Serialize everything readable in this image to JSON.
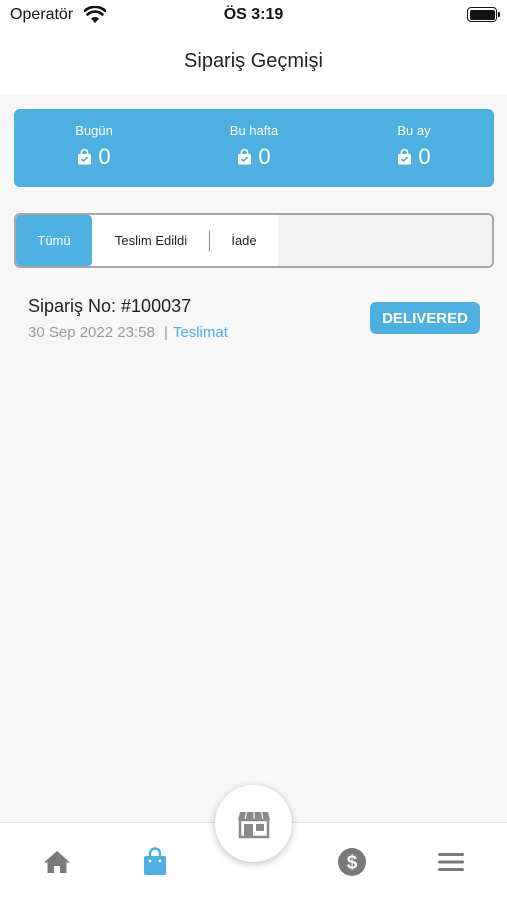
{
  "status_bar": {
    "carrier": "Operatör",
    "time": "ÖS 3:19"
  },
  "header": {
    "title": "Sipariş Geçmişi"
  },
  "stats": [
    {
      "label": "Bugün",
      "value": "0",
      "icon": "bag-icon"
    },
    {
      "label": "Bu hafta",
      "value": "0",
      "icon": "bag-icon"
    },
    {
      "label": "Bu ay",
      "value": "0",
      "icon": "bag-icon"
    }
  ],
  "tabs": {
    "all": "Tümü",
    "delivered": "Teslim Edildi",
    "return": "İade",
    "active": "all"
  },
  "orders": [
    {
      "order_no": "Sipariş No: #100037",
      "date": "30 Sep 2022",
      "time": "23:58",
      "separator": "|",
      "type": "Teslimat",
      "status": "DELIVERED"
    }
  ],
  "bottom_nav": {
    "items": [
      "home-icon",
      "shopping-bag-icon",
      "store-icon",
      "dollar-icon",
      "menu-icon"
    ],
    "active": "shopping-bag-icon"
  },
  "colors": {
    "accent": "#4db0e0",
    "icon_gray": "#7a7a7a",
    "muted_text": "#9a9a9a"
  }
}
